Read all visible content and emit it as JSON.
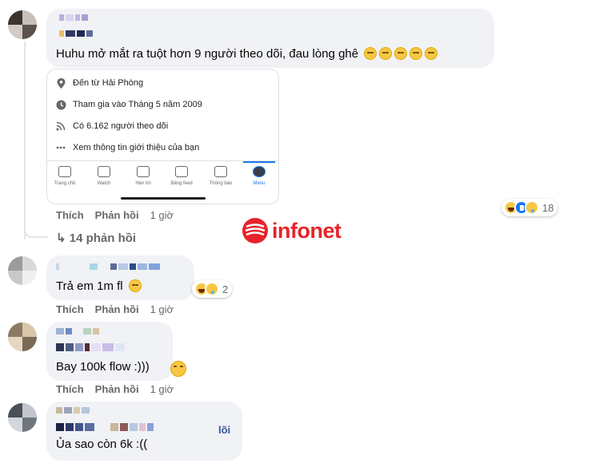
{
  "comments": [
    {
      "text": "Huhu mở mắt ra tuột hơn 9 người theo dõi, đau lòng ghê",
      "emoji_count": 5,
      "actions": {
        "like": "Thích",
        "reply": "Phản hồi",
        "time": "1 giờ"
      },
      "reaction_count": "18",
      "replies_label": "14 phản hồi"
    },
    {
      "text": "Trả em 1m fl",
      "actions": {
        "like": "Thích",
        "reply": "Phản hồi",
        "time": "1 giờ"
      },
      "reaction_count": "2"
    },
    {
      "text": "Bay 100k flow :)))",
      "actions": {
        "like": "Thích",
        "reply": "Phản hồi",
        "time": "1 giờ"
      }
    },
    {
      "name_suffix": "lõi",
      "text": "Ủa sao còn 6k :(("
    }
  ],
  "embed": {
    "info": [
      {
        "icon": "location-pin-icon",
        "text": "Đến từ Hải Phòng"
      },
      {
        "icon": "clock-icon",
        "text": "Tham gia vào Tháng 5 năm 2009"
      },
      {
        "icon": "rss-icon",
        "text": "Có 6.162 người theo dõi"
      },
      {
        "icon": "more-dots-icon",
        "text": "Xem thông tin giới thiệu của bạn"
      }
    ],
    "tabs": [
      {
        "icon": "home-icon",
        "label": "Trang chủ"
      },
      {
        "icon": "video-icon",
        "label": "Watch"
      },
      {
        "icon": "heart-icon",
        "label": "Hẹn hò"
      },
      {
        "icon": "feed-icon",
        "label": "Bảng feed"
      },
      {
        "icon": "bell-icon",
        "label": "Thông báo"
      },
      {
        "icon": "profile-avatar-icon",
        "label": "Menu"
      }
    ]
  },
  "watermark": {
    "text": "infonet",
    "color": "#e8232b"
  },
  "colors": {
    "bubble": "#f0f2f5",
    "muted": "#65676b",
    "accent": "#1877f2"
  }
}
